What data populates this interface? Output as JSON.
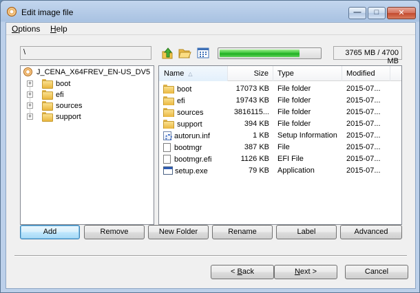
{
  "window": {
    "title": "Edit image file"
  },
  "menu": {
    "options_u": "O",
    "options_rest": "ptions",
    "help_u": "H",
    "help_rest": "elp"
  },
  "toolbar": {
    "path": "\\",
    "disc_usage_fraction": 0.8,
    "disc_usage_text": "3765 MB / 4700 MB"
  },
  "tree": {
    "root": "J_CENA_X64FREV_EN-US_DV5",
    "children": [
      "boot",
      "efi",
      "sources",
      "support"
    ]
  },
  "list": {
    "columns": [
      "Name",
      "Size",
      "Type",
      "Modified"
    ],
    "rows": [
      {
        "name": "boot",
        "size": "17073 KB",
        "type": "File folder",
        "modified": "2015-07...",
        "icon": "folder-icon"
      },
      {
        "name": "efi",
        "size": "19743 KB",
        "type": "File folder",
        "modified": "2015-07...",
        "icon": "folder-icon"
      },
      {
        "name": "sources",
        "size": "3816115...",
        "type": "File folder",
        "modified": "2015-07...",
        "icon": "folder-icon"
      },
      {
        "name": "support",
        "size": "394 KB",
        "type": "File folder",
        "modified": "2015-07...",
        "icon": "folder-icon"
      },
      {
        "name": "autorun.inf",
        "size": "1 KB",
        "type": "Setup Information",
        "modified": "2015-07...",
        "icon": "setup-info-icon"
      },
      {
        "name": "bootmgr",
        "size": "387 KB",
        "type": "File",
        "modified": "2015-07...",
        "icon": "file-icon"
      },
      {
        "name": "bootmgr.efi",
        "size": "1126 KB",
        "type": "EFI File",
        "modified": "2015-07...",
        "icon": "file-icon"
      },
      {
        "name": "setup.exe",
        "size": "79 KB",
        "type": "Application",
        "modified": "2015-07...",
        "icon": "application-icon"
      }
    ]
  },
  "actions": {
    "add": "Add",
    "remove": "Remove",
    "new_folder": "New Folder",
    "rename": "Rename",
    "label": "Label",
    "advanced": "Advanced"
  },
  "nav": {
    "back_prefix": "< ",
    "back_u": "B",
    "back_rest": "ack",
    "next_u": "N",
    "next_rest": "ext",
    "next_suffix": " >",
    "cancel": "Cancel"
  },
  "colors": {
    "progress_green": "#2fbd2f",
    "selection": "#3399ff"
  }
}
